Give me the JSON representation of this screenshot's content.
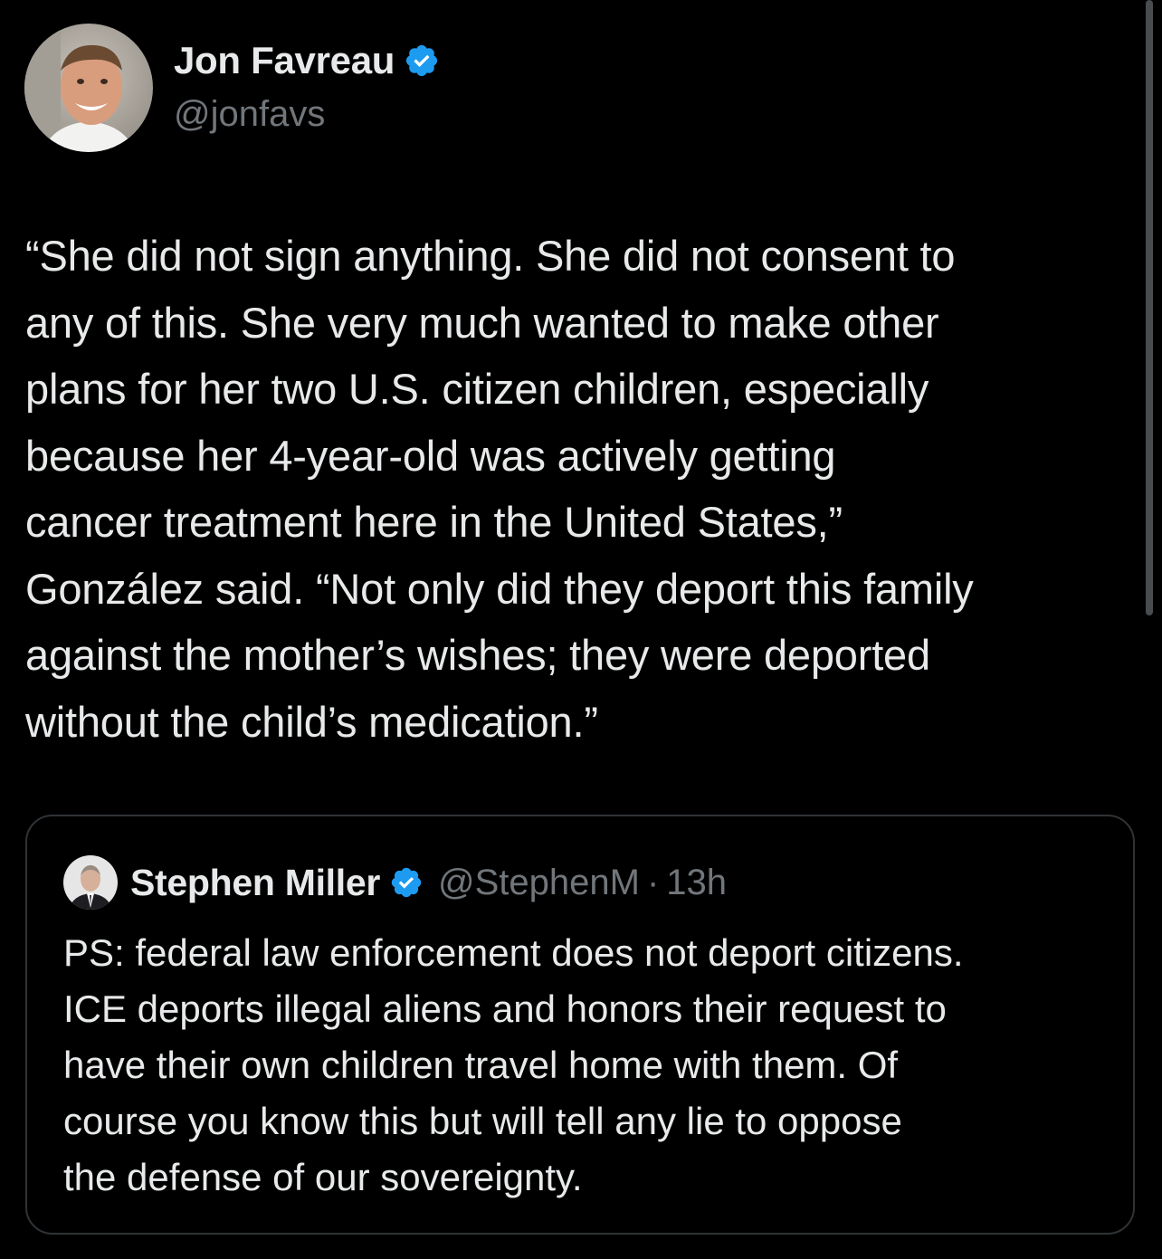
{
  "tweet": {
    "author": {
      "name": "Jon Favreau",
      "handle": "@jonfavs",
      "verified": true
    },
    "text": "“She did not sign anything. She did not consent to\nany of this. She very much wanted to make other\nplans for her two U.S. citizen children, especially\nbecause her 4-year-old was actively getting\ncancer treatment here in the United States,”\nGonzález said. “Not only did they deport this family\nagainst the mother’s wishes; they were deported\nwithout the child’s medication.”"
  },
  "quoted_tweet": {
    "author": {
      "name": "Stephen Miller",
      "handle": "@StephenM",
      "verified": true
    },
    "separator": "·",
    "time": "13h",
    "text": "PS: federal law enforcement does not deport citizens.\nICE deports illegal aliens and honors their request to\nhave their own children travel home with them. Of\ncourse you know this but will tell any lie to oppose\nthe defense of our sovereignty."
  },
  "icons": {
    "verified": "verified-badge-icon"
  },
  "colors": {
    "background": "#000000",
    "primary_text": "#e7e9ea",
    "secondary_text": "#71767b",
    "verified_blue": "#1d9bf0",
    "border": "#2f3336"
  }
}
